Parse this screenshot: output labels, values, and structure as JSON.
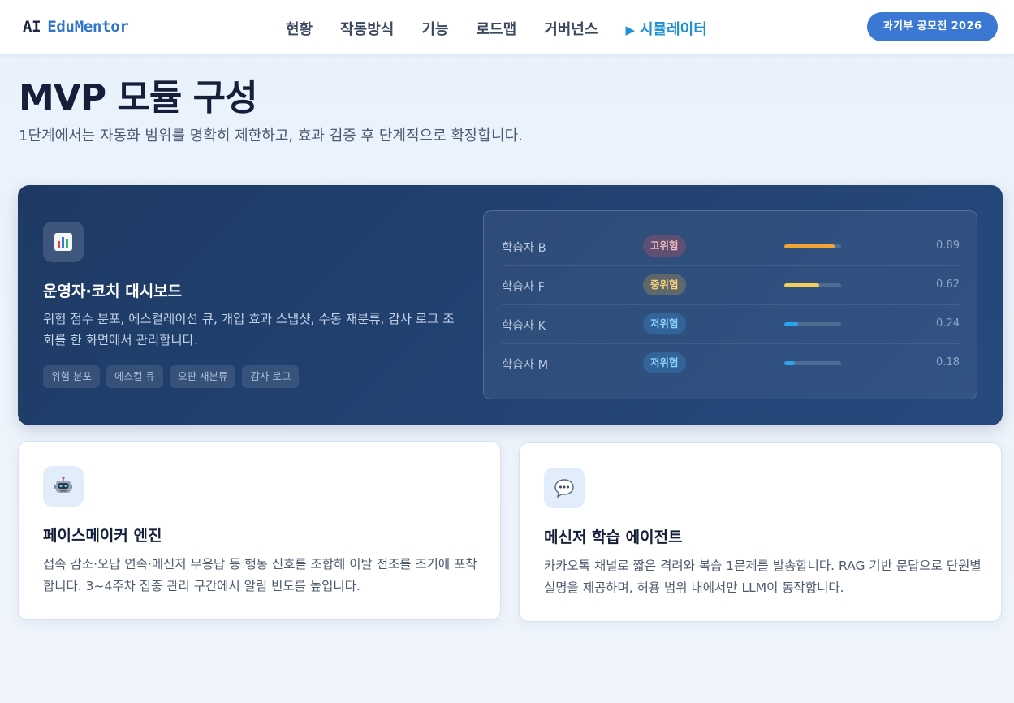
{
  "header": {
    "logo_ai": "AI",
    "logo_brand": "EduMentor",
    "nav": [
      {
        "label": "현황"
      },
      {
        "label": "작동방식"
      },
      {
        "label": "기능"
      },
      {
        "label": "로드맵"
      },
      {
        "label": "거버넌스"
      },
      {
        "label": "시뮬레이터",
        "active": true
      }
    ],
    "cta_label": "과기부 공모전 2026"
  },
  "page": {
    "title": "MVP 모듈 구성",
    "subtitle": "1단계에서는 자동화 범위를 명확히 제한하고, 효과 검증 후 단계적으로 확장합니다."
  },
  "dashboard": {
    "icon": "bar-chart-icon",
    "title": "운영자·코치 대시보드",
    "description": "위험 점수 분포, 에스컬레이션 큐, 개입 효과 스냅샷, 수동 재분류, 감사 로그 조회를 한 화면에서 관리합니다.",
    "chips": [
      "위험 분포",
      "에스컬 큐",
      "오판 재분류",
      "감사 로그"
    ],
    "learners": [
      {
        "name": "학습자 B",
        "risk": "고위험",
        "level": "high",
        "score": "0.89",
        "fill": 0.89,
        "color": "#f2a531"
      },
      {
        "name": "학습자 F",
        "risk": "중위험",
        "level": "mid",
        "score": "0.62",
        "fill": 0.62,
        "color": "#f3cf5a"
      },
      {
        "name": "학습자 K",
        "risk": "저위험",
        "level": "low",
        "score": "0.24",
        "fill": 0.24,
        "color": "#2ea2ef"
      },
      {
        "name": "학습자 M",
        "risk": "저위험",
        "level": "low",
        "score": "0.18",
        "fill": 0.18,
        "color": "#2ea2ef"
      }
    ]
  },
  "modules": [
    {
      "icon": "robot-icon",
      "title": "페이스메이커 엔진",
      "description": "접속 감소·오답 연속·메신저 무응답 등 행동 신호를 조합해 이탈 전조를 조기에 포착합니다. 3~4주차 집중 관리 구간에서 알림 빈도를 높입니다."
    },
    {
      "icon": "speech-bubble-icon",
      "title": "메신저 학습 에이전트",
      "description": "카카오톡 채널로 짧은 격려와 복습 1문제를 발송합니다. RAG 기반 문답으로 단원별 설명을 제공하며, 허용 범위 내에서만 LLM이 동작합니다."
    }
  ]
}
